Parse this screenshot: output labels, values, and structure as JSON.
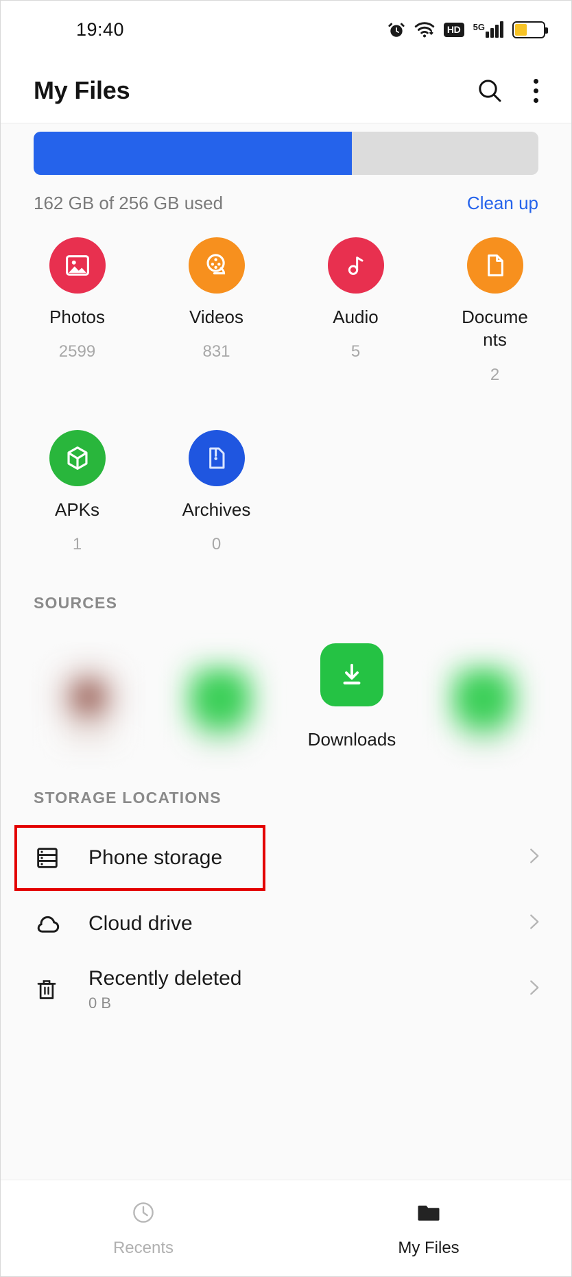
{
  "status_bar": {
    "time": "19:40",
    "icons": [
      "alarm-icon",
      "wifi-icon",
      "hd-icon",
      "5g-icon",
      "signal-icon",
      "battery-icon"
    ],
    "hd_label": "HD",
    "network_label": "5G"
  },
  "app_bar": {
    "title": "My Files",
    "search_label": "Search",
    "menu_label": "More options"
  },
  "storage": {
    "used_percent": 63,
    "usage_text": "162 GB of 256 GB used",
    "cleanup_label": "Clean up",
    "bar_fill_color": "#2563eb",
    "bar_track_color": "#dcdcdc",
    "link_color": "#2563eb"
  },
  "categories": [
    {
      "label": "Photos",
      "count": "2599",
      "icon": "photo-icon",
      "color": "#e8304f"
    },
    {
      "label": "Videos",
      "count": "831",
      "icon": "video-icon",
      "color": "#f7901e"
    },
    {
      "label": "Audio",
      "count": "5",
      "icon": "audio-icon",
      "color": "#e8304f"
    },
    {
      "label": "Documents",
      "count": "2",
      "icon": "document-icon",
      "color": "#f7901e"
    },
    {
      "label": "APKs",
      "count": "1",
      "icon": "apk-icon",
      "color": "#29b63c"
    },
    {
      "label": "Archives",
      "count": "0",
      "icon": "archive-icon",
      "color": "#1f56e0"
    }
  ],
  "sources": {
    "heading": "SOURCES",
    "items": [
      {
        "label": "",
        "icon": "blurred-app-icon",
        "blurred": true
      },
      {
        "label": "",
        "icon": "blurred-app-icon",
        "blurred": true
      },
      {
        "label": "Downloads",
        "icon": "download-icon",
        "blurred": false,
        "color": "#25c244"
      },
      {
        "label": "",
        "icon": "blurred-app-icon",
        "blurred": true
      }
    ]
  },
  "storage_locations": {
    "heading": "STORAGE LOCATIONS",
    "items": [
      {
        "title": "Phone storage",
        "subtitle": "",
        "icon": "phone-storage-icon",
        "highlighted": true
      },
      {
        "title": "Cloud drive",
        "subtitle": "",
        "icon": "cloud-icon",
        "highlighted": false
      },
      {
        "title": "Recently deleted",
        "subtitle": "0 B",
        "icon": "trash-icon",
        "highlighted": false
      }
    ],
    "chevron": "›",
    "highlight_color": "#e30000"
  },
  "bottom_nav": {
    "items": [
      {
        "label": "Recents",
        "icon": "clock-icon",
        "active": false
      },
      {
        "label": "My Files",
        "icon": "folder-icon",
        "active": true
      }
    ]
  }
}
